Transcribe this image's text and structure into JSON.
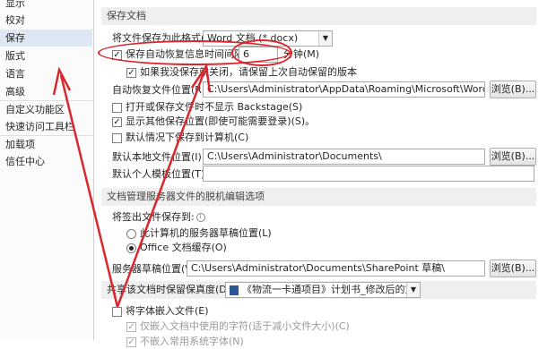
{
  "sidebar": {
    "items": [
      {
        "label": "显示",
        "selected": false
      },
      {
        "label": "校对",
        "selected": false
      },
      {
        "label": "保存",
        "selected": true
      },
      {
        "label": "版式",
        "selected": false
      },
      {
        "label": "语言",
        "selected": false
      },
      {
        "label": "高级",
        "selected": false
      },
      {
        "label": "自定义功能区",
        "selected": false
      },
      {
        "label": "快速访问工具栏",
        "selected": false
      },
      {
        "label": "加载项",
        "selected": false
      },
      {
        "label": "信任中心",
        "selected": false
      }
    ]
  },
  "save_section": {
    "header": "保存文档",
    "format_label": "将文件保存为此格式(F):",
    "format_value": "Word 文档 (*.docx)",
    "autosave": {
      "label": "保存自动恢复信息时间间隔(A)",
      "checked": true,
      "value": "6",
      "unit": "分钟(M)"
    },
    "keep_last": {
      "label": "如果我没保存就关闭，请保留上次自动保留的版本",
      "checked": true
    },
    "recover_path_label": "自动恢复文件位置(R):",
    "recover_path_value": "C:\\Users\\Administrator\\AppData\\Roaming\\Microsoft\\Word\\",
    "browse1": "浏览(B)...",
    "no_backstage": {
      "label": "打开或保存文件时不显示 Backstage(S)",
      "checked": false
    },
    "show_other": {
      "label": "显示其他保存位置(即使可能需要登录)(S)。",
      "checked": true
    },
    "default_pc": {
      "label": "默认情况下保存到计算机(C)",
      "checked": false
    },
    "local_path_label": "默认本地文件位置(I):",
    "local_path_value": "C:\\Users\\Administrator\\Documents\\",
    "browse2": "浏览(B)...",
    "template_label": "默认个人模板位置(T):",
    "template_value": ""
  },
  "offline_section": {
    "header": "文档管理服务器文件的脱机编辑选项",
    "checkout_label": "将签出文件保存到:",
    "opt_server": {
      "label": "此计算机的服务器草稿位置(L)",
      "selected": false
    },
    "opt_cache": {
      "label": "Office 文档缓存(O)",
      "selected": true
    },
    "drafts_label": "服务器草稿位置(V):",
    "drafts_value": "C:\\Users\\Administrator\\Documents\\SharePoint 草稿\\",
    "browse3": "浏览(B)..."
  },
  "fidelity_section": {
    "label": "共享该文档时保留保真度(D):",
    "doc_value": "《物流一卡通项目》计划书_修改后的文件.docx",
    "embed_fonts": {
      "label": "将字体嵌入文件(E)",
      "checked": false
    },
    "embed_used_only": {
      "label": "仅嵌入文档中使用的字符(适于减小文件大小)(C)",
      "checked": true
    },
    "no_common": {
      "label": "不嵌入常用系统字体(N)",
      "checked": true
    }
  },
  "colors": {
    "selected_nav": "#dde7f5",
    "annotation_red": "#d9272e",
    "section_header": "#efefef"
  }
}
